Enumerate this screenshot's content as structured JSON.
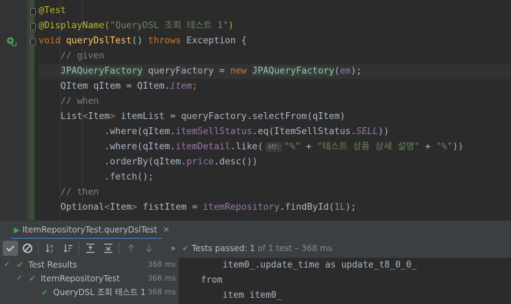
{
  "editor": {
    "lines": [
      {
        "id": "l1",
        "parts": [
          [
            "ann",
            "@Test"
          ]
        ]
      },
      {
        "id": "l2",
        "parts": [
          [
            "ann",
            "@DisplayName("
          ],
          [
            "str",
            "\"QueryDSL 조회 테스트 1\""
          ],
          [
            "ann",
            ")"
          ]
        ]
      },
      {
        "id": "l3",
        "parts": [
          [
            "kw",
            "void "
          ],
          [
            "fn",
            "queryDslTest"
          ],
          [
            "typ",
            "() "
          ],
          [
            "kw",
            "throws "
          ],
          [
            "typ",
            "Exception {"
          ]
        ]
      },
      {
        "id": "l4",
        "parts": [
          [
            "cm",
            "    // given"
          ]
        ]
      },
      {
        "id": "l5",
        "parts": [
          [
            "typ",
            "    "
          ],
          [
            "warn",
            "JPAQueryFactory"
          ],
          [
            "typ",
            " queryFactory = "
          ],
          [
            "kw",
            "new "
          ],
          [
            "warn",
            "JPAQueryFactory"
          ],
          [
            "typ",
            "("
          ],
          [
            "fld",
            "em"
          ],
          [
            "typ",
            ");"
          ]
        ]
      },
      {
        "id": "l6",
        "parts": [
          [
            "typ",
            "    QItem qItem = QItem."
          ],
          [
            "ifld",
            "item"
          ],
          [
            "kw",
            ";"
          ]
        ]
      },
      {
        "id": "l7",
        "parts": [
          [
            "cm",
            "    // when"
          ]
        ]
      },
      {
        "id": "l8",
        "parts": [
          [
            "typ",
            "    List"
          ],
          [
            "kw",
            "<"
          ],
          [
            "typ",
            "Item"
          ],
          [
            "kw",
            "> "
          ],
          [
            "typ",
            "itemList = queryFactory.selectFrom(qItem)"
          ]
        ]
      },
      {
        "id": "l9",
        "parts": [
          [
            "typ",
            "            .where(qItem."
          ],
          [
            "fld",
            "itemSellStatus"
          ],
          [
            "typ",
            ".eq(ItemSellStatus."
          ],
          [
            "ifld",
            "SELL"
          ],
          [
            "typ",
            "))"
          ]
        ]
      },
      {
        "id": "l10",
        "parts": [
          [
            "typ",
            "            .where(qItem."
          ],
          [
            "fld",
            "itemDetail"
          ],
          [
            "typ",
            ".like("
          ],
          [
            "hint",
            "str:"
          ],
          [
            "str",
            "\"%\""
          ],
          [
            "typ",
            " + "
          ],
          [
            "str",
            "\"테스트 상품 상세 설명\""
          ],
          [
            "typ",
            " + "
          ],
          [
            "str",
            "\"%\""
          ],
          [
            "typ",
            "))"
          ]
        ]
      },
      {
        "id": "l11",
        "parts": [
          [
            "typ",
            "            .orderBy(qItem."
          ],
          [
            "fld",
            "price"
          ],
          [
            "typ",
            ".desc())"
          ]
        ]
      },
      {
        "id": "l12",
        "parts": [
          [
            "typ",
            "            .fetch();"
          ]
        ]
      },
      {
        "id": "l13",
        "parts": [
          [
            "cm",
            "    // then"
          ]
        ]
      },
      {
        "id": "l14",
        "parts": [
          [
            "typ",
            "    Optional"
          ],
          [
            "kw",
            "<"
          ],
          [
            "typ",
            "Item"
          ],
          [
            "kw",
            "> "
          ],
          [
            "typ",
            "fistItem = "
          ],
          [
            "fld",
            "itemRepository"
          ],
          [
            "typ",
            ".findById("
          ],
          [
            "num",
            "1L"
          ],
          [
            "typ",
            ");"
          ]
        ]
      }
    ]
  },
  "panel": {
    "tab_label": "ItemRepositoryTest.queryDslTest",
    "status": {
      "prefix": "Tests passed: ",
      "count": "1",
      "rest": " of 1 test – 368 ms"
    },
    "tree": [
      {
        "label": "Test Results",
        "time": "368 ms"
      },
      {
        "label": "ItemRepositoryTest",
        "time": "368 ms"
      },
      {
        "label": "QueryDSL 조회 테스트 1",
        "time": "368 ms"
      }
    ],
    "console": [
      "        item0_.update_time as update_t8_0_0_",
      "    from",
      "        item item0_"
    ]
  }
}
